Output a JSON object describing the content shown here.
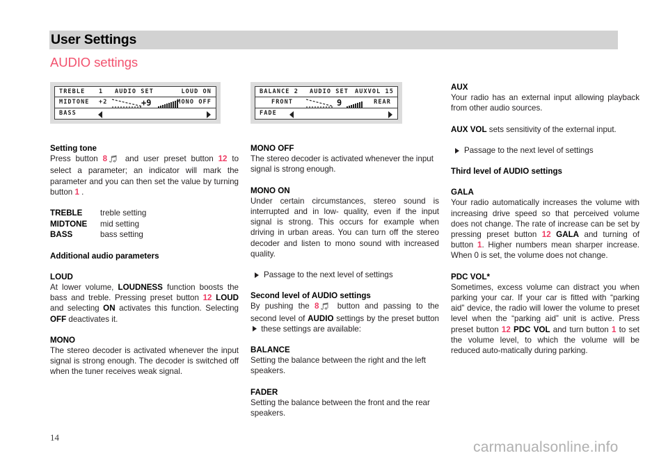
{
  "header": {
    "title": "User Settings",
    "subtitle": "AUDIO settings"
  },
  "displays": {
    "display1": {
      "name": "audio-set-tone-display",
      "row1_left": "TREBLE",
      "row1_value": "1",
      "row1_center": "AUDIO SET",
      "row1_right": "LOUD ON",
      "row2_left": "MIDTONE",
      "row2_value": "+2",
      "row2_big": "+9",
      "row2_right": "MONO OFF",
      "row3_left": "BASS",
      "bars": [
        2,
        3,
        4,
        5,
        6,
        7,
        8,
        9,
        10,
        11
      ]
    },
    "display2": {
      "name": "audio-set-balance-display",
      "row1_left": "BALANCE 2",
      "row1_center": "AUDIO SET",
      "row1_right": "AUXVOL 15",
      "row2_left": "FRONT",
      "row2_big": "9",
      "row2_right": "REAR",
      "row3_left": "FADE",
      "bars": [
        2,
        3,
        4,
        5,
        6,
        7,
        8,
        9
      ]
    }
  },
  "column1": {
    "setting_tone_heading": "Setting tone",
    "setting_tone_p1_a": "Press button ",
    "setting_tone_p1_n1": "8",
    "setting_tone_p1_b": " and user preset button ",
    "setting_tone_p1_n2": "12",
    "setting_tone_p1_c": " to select a parameter; an indicator will mark the parameter and you can then set the value by turning button ",
    "setting_tone_p1_n3": "1",
    "setting_tone_p1_d": " .",
    "definitions": [
      {
        "term": "TREBLE",
        "desc": "treble setting"
      },
      {
        "term": "MIDTONE",
        "desc": "mid setting"
      },
      {
        "term": "BASS",
        "desc": "bass setting"
      }
    ],
    "additional_heading": "Additional audio parameters",
    "loud_heading": "LOUD",
    "loud_p_a": "At lower volume, ",
    "loud_p_b": "LOUDNESS",
    "loud_p_c": " function boosts the bass and treble. Pressing preset button ",
    "loud_p_n": "12",
    "loud_p_d": " ",
    "loud_p_e": "LOUD",
    "loud_p_f": " and selecting ",
    "loud_p_g": "ON",
    "loud_p_h": " activates this function. Selecting ",
    "loud_p_i": "OFF",
    "loud_p_j": " deactivates it.",
    "mono_heading": "MONO",
    "mono_p": "The stereo decoder is activated whenever the input signal is strong enough. The decoder is switched off when the tuner receives weak signal."
  },
  "column2": {
    "mono_off_heading": "MONO OFF",
    "mono_off_p": "The stereo decoder is activated whenever the input signal is strong enough.",
    "mono_on_heading": "MONO ON",
    "mono_on_p": "Under certain circumstances, stereo sound is interrupted and in low- quality, even if the input signal is strong. This occurs for example when driving in urban areas. You can turn off the stereo decoder and listen to mono sound with increased quality.",
    "passage": "Passage to the next level of settings",
    "second_level_heading": "Second level of AUDIO settings",
    "second_level_p_a": "By pushing the ",
    "second_level_p_n": "8",
    "second_level_p_b": " button and passing to the second level of ",
    "second_level_p_c": "AUDIO",
    "second_level_p_d": " settings by the preset button ",
    "second_level_p_e": " these settings are available:",
    "balance_heading": "BALANCE",
    "balance_p": "Setting the balance between the right and the left speakers.",
    "fader_heading": "FADER",
    "fader_p": "Setting the balance between the front and the rear speakers."
  },
  "column3": {
    "aux_heading": "AUX",
    "aux_p": "Your radio has an external input allowing playback from other audio sources.",
    "auxvol_bold": "AUX VOL",
    "auxvol_rest": "  sets sensitivity of the external input.",
    "passage": "Passage to the next level of settings",
    "third_level_heading": "Third level of AUDIO settings",
    "gala_heading": "GALA",
    "gala_p_a": "Your radio automatically increases the volume with increasing drive speed so that perceived volume does not change. The rate of increase can be set by pressing preset button ",
    "gala_p_n1": "12",
    "gala_p_b": " ",
    "gala_p_c": "GALA",
    "gala_p_d": " and turning of button ",
    "gala_p_n2": "1",
    "gala_p_e": ". Higher numbers mean sharper increase. When 0 is set, the volume does not change.",
    "pdc_heading": "PDC VOL*",
    "pdc_p_a": "Sometimes, excess volume can distract you when parking your car. If your car is fitted with “parking aid” device, the radio will lower the volume to preset level when the “parking aid” unit is active. Press preset button ",
    "pdc_p_n1": "12",
    "pdc_p_b": " ",
    "pdc_p_c": "PDC VOL",
    "pdc_p_d": " and turn button ",
    "pdc_p_n2": "1",
    "pdc_p_e": " to set the volume level, to which the volume will be reduced auto-matically during parking."
  },
  "footer": {
    "page_number": "14",
    "watermark": "carmanualsonline.info"
  },
  "colors": {
    "accent_pink": "#ee3b63",
    "title_pink": "#f2526e",
    "header_gray": "#d2d2d2",
    "text": "#231f20"
  }
}
